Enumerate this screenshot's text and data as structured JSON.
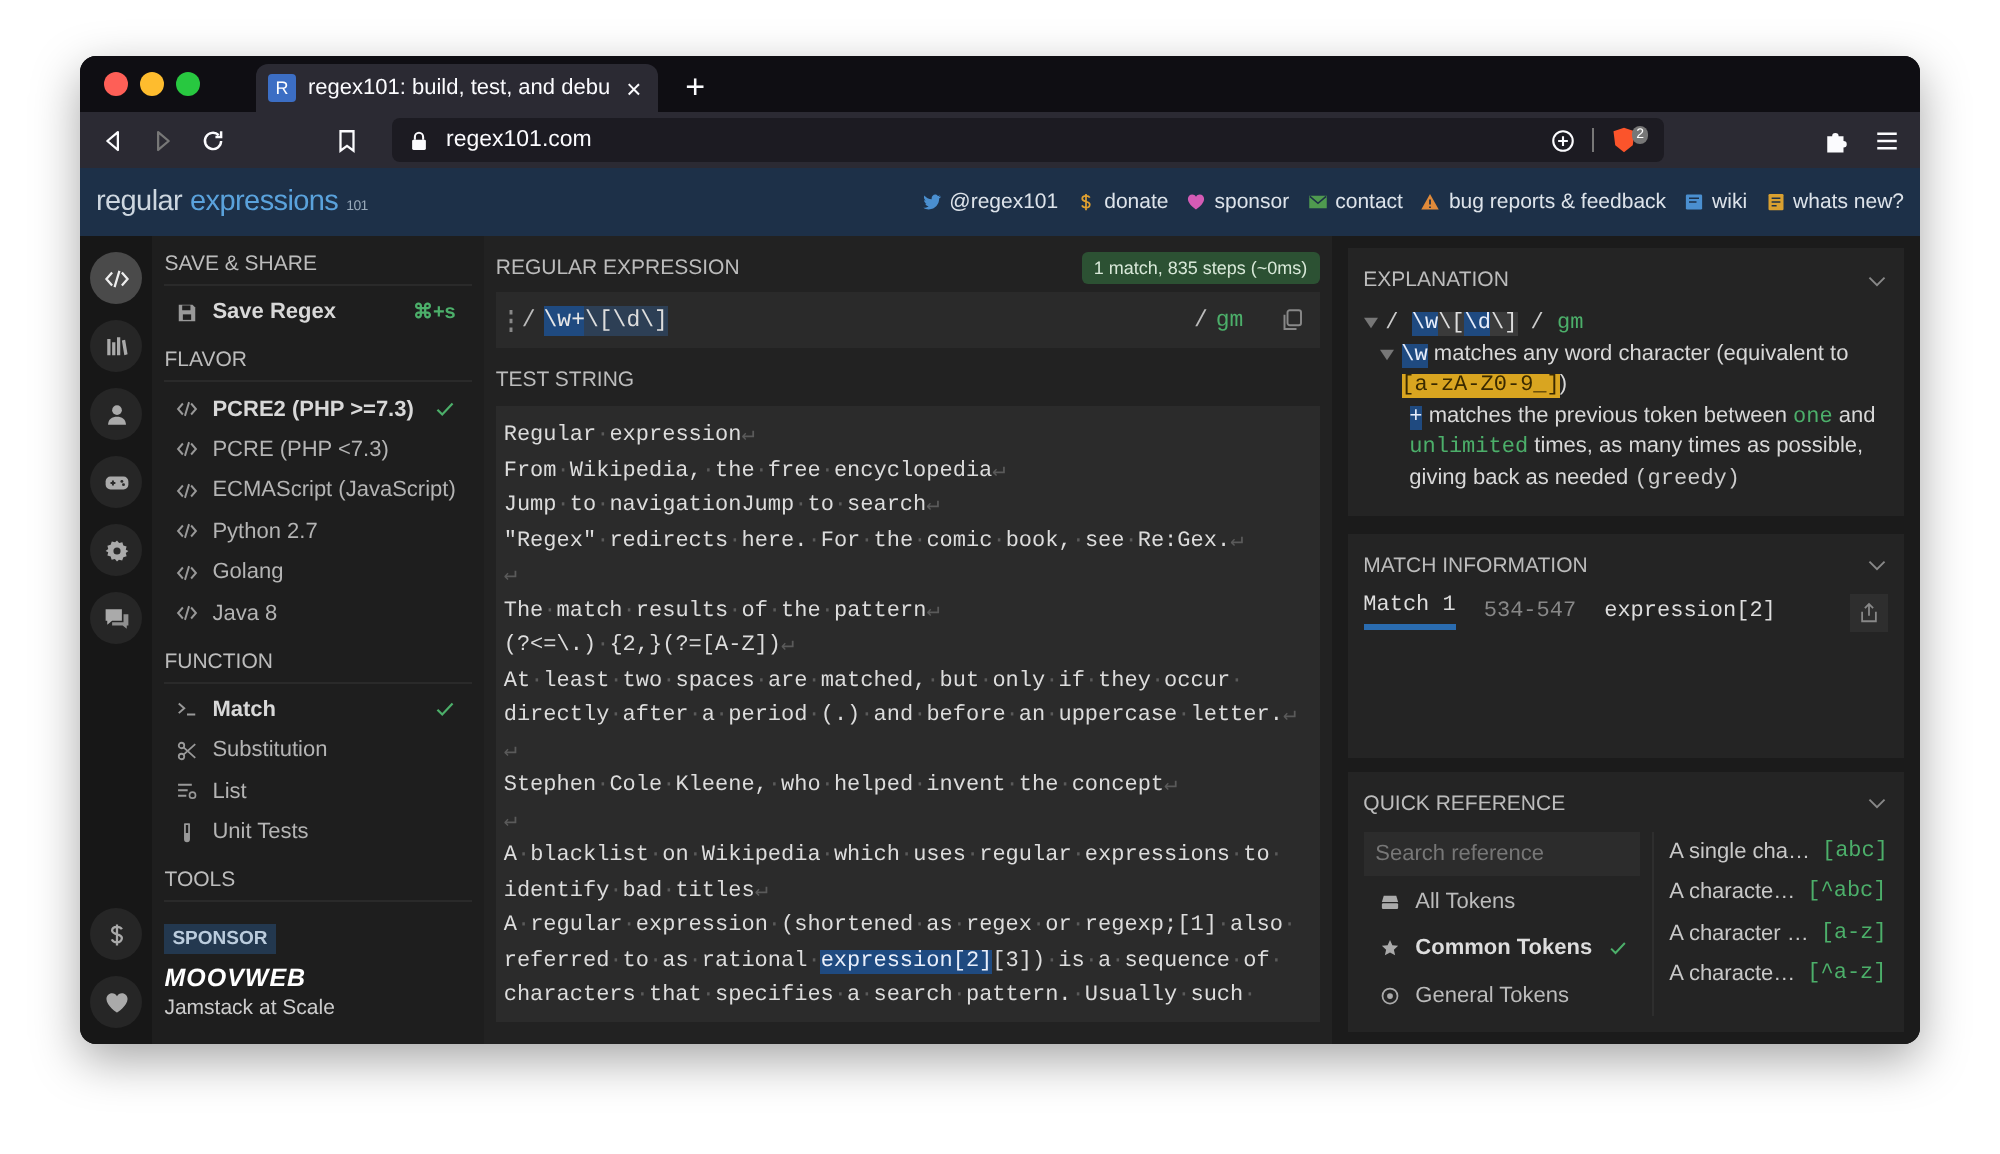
{
  "browser": {
    "favicon": "R",
    "tab_title": "regex101: build, test, and debu",
    "tab_close": "×",
    "new_tab": "+",
    "url": "regex101.com",
    "shield_count": "2"
  },
  "header": {
    "logo": {
      "word1": "regular",
      "word2": "expressions",
      "version": "101"
    },
    "links": [
      {
        "kind": "bird",
        "label": "@regex101",
        "color": "#4a8fd0"
      },
      {
        "kind": "dollar",
        "label": "donate",
        "color": "#e0a030"
      },
      {
        "kind": "heart",
        "label": "sponsor",
        "color": "#d45bb5"
      },
      {
        "kind": "mail",
        "label": "contact",
        "color": "#4f9a4f"
      },
      {
        "kind": "warning",
        "label": "bug reports & feedback",
        "color": "#e08a3a"
      },
      {
        "kind": "book",
        "label": "wiki",
        "color": "#4a8fd0"
      },
      {
        "kind": "note",
        "label": "whats new?",
        "color": "#d9a030"
      }
    ]
  },
  "rail": {
    "items": [
      {
        "kind": "code",
        "selected": true
      },
      {
        "kind": "library",
        "selected": false
      },
      {
        "kind": "user",
        "selected": false
      },
      {
        "kind": "gamepad",
        "selected": false
      },
      {
        "kind": "gear",
        "selected": false
      },
      {
        "kind": "chat",
        "selected": false
      }
    ],
    "bottom": [
      {
        "kind": "dollar"
      },
      {
        "kind": "heart"
      }
    ]
  },
  "sidebar": {
    "sections": [
      {
        "title": "SAVE & SHARE",
        "items": [
          {
            "kind": "save",
            "label": "Save Regex",
            "shortcut": "⌘+s"
          }
        ]
      },
      {
        "title": "FLAVOR",
        "items": [
          {
            "kind": "code",
            "label": "PCRE2 (PHP >=7.3)",
            "selected": true
          },
          {
            "kind": "code",
            "label": "PCRE (PHP <7.3)",
            "selected": false
          },
          {
            "kind": "code",
            "label": "ECMAScript (JavaScript)",
            "selected": false
          },
          {
            "kind": "code",
            "label": "Python 2.7",
            "selected": false
          },
          {
            "kind": "code",
            "label": "Golang",
            "selected": false
          },
          {
            "kind": "code",
            "label": "Java 8",
            "selected": false
          }
        ]
      },
      {
        "title": "FUNCTION",
        "items": [
          {
            "kind": "prompt",
            "label": "Match",
            "selected": true
          },
          {
            "kind": "scissors",
            "label": "Substitution",
            "selected": false
          },
          {
            "kind": "list",
            "label": "List",
            "selected": false
          },
          {
            "kind": "tube",
            "label": "Unit Tests",
            "selected": false
          }
        ]
      },
      {
        "title": "TOOLS"
      }
    ],
    "sponsor": {
      "badge": "SPONSOR",
      "brand": "MOOVWEB",
      "tagline": "Jamstack at Scale"
    }
  },
  "editor": {
    "regex_title": "REGULAR EXPRESSION",
    "status": "1 match, 835 steps (~0ms)",
    "delimiter": "/",
    "tokens": [
      {
        "text": "\\w+",
        "kind": "token"
      },
      {
        "text": "\\[\\d\\]",
        "kind": "literal"
      }
    ],
    "closing_delimiter": "/",
    "flags": "gm",
    "test_title": "TEST STRING",
    "lines": [
      {
        "text": "Regular·expression↵"
      },
      {
        "text": "From·Wikipedia,·the·free·encyclopedia↵"
      },
      {
        "text": "Jump·to·navigationJump·to·search↵"
      },
      {
        "text": "\"Regex\"·redirects·here.·For·the·comic·book,·see·Re:Gex.↵"
      },
      {
        "text": "↵"
      },
      {
        "text": "The·match·results·of·the·pattern↵"
      },
      {
        "text": "(?<=\\.)·{2,}(?=[A-Z])↵"
      },
      {
        "text": "At·least·two·spaces·are·matched,·but·only·if·they·occur·"
      },
      {
        "text": "directly·after·a·period·(.)·and·before·an·uppercase·letter.↵"
      },
      {
        "text": "↵"
      },
      {
        "text": "Stephen·Cole·Kleene,·who·helped·invent·the·concept↵"
      },
      {
        "text": "↵"
      },
      {
        "text": "A·blacklist·on·Wikipedia·which·uses·regular·expressions·to·"
      },
      {
        "text": "identify·bad·titles↵"
      },
      {
        "text": "A·regular·expression·(shortened·as·regex·or·regexp;[1]·also·"
      },
      {
        "parts": [
          {
            "text": "referred·to·as·rational·",
            "match": false
          },
          {
            "text": "expression[2]",
            "match": true
          },
          {
            "text": "[3])·is·a·sequence·of·",
            "match": false
          }
        ]
      },
      {
        "text": "characters·that·specifies·a·search·pattern.·Usually·such·"
      }
    ]
  },
  "explanation": {
    "title": "EXPLANATION",
    "tree": {
      "kind": "group",
      "expanded": true,
      "parts": [
        {
          "text": "/ ",
          "kind": "mono"
        },
        {
          "text": "\\w",
          "kind": "token"
        },
        {
          "text": "\\[",
          "kind": "literal"
        },
        {
          "text": "\\d",
          "kind": "token"
        },
        {
          "text": "\\]",
          "kind": "literal"
        },
        {
          "text": " / ",
          "kind": "mono"
        },
        {
          "text": "gm",
          "kind": "code"
        }
      ],
      "children": [
        {
          "kind": "group",
          "expanded": true,
          "parts": [
            {
              "text": "\\w",
              "kind": "token"
            },
            {
              "text": " matches any word character (equivalent to ",
              "kind": "plain"
            },
            {
              "text": "[a-zA-Z0-9_]",
              "kind": "class"
            },
            {
              "text": ")",
              "kind": "plain"
            }
          ],
          "children": [
            {
              "kind": "leaf",
              "parts": [
                {
                  "text": "+",
                  "kind": "token"
                },
                {
                  "text": " matches the previous token between ",
                  "kind": "plain"
                },
                {
                  "text": "one",
                  "kind": "code"
                },
                {
                  "text": " and ",
                  "kind": "plain"
                },
                {
                  "text": "unlimited",
                  "kind": "code"
                },
                {
                  "text": " times, as many times as possible, giving back as needed ",
                  "kind": "plain"
                },
                {
                  "text": "(greedy)",
                  "kind": "mono"
                }
              ]
            }
          ]
        }
      ]
    }
  },
  "match_info": {
    "title": "MATCH INFORMATION",
    "tabs": [
      {
        "label": "Match 1",
        "selected": true
      }
    ],
    "range": "534-547",
    "value": "expression[2]"
  },
  "quick_reference": {
    "title": "QUICK REFERENCE",
    "search_placeholder": "Search reference",
    "categories": [
      {
        "kind": "stack",
        "label": "All Tokens",
        "selected": false
      },
      {
        "kind": "star",
        "label": "Common Tokens",
        "selected": true
      },
      {
        "kind": "target",
        "label": "General Tokens",
        "selected": false
      }
    ],
    "tokens": [
      {
        "description": "A single cha…",
        "token": "[abc]"
      },
      {
        "description": "A characte…",
        "token": "[^abc]"
      },
      {
        "description": "A character …",
        "token": "[a-z]"
      },
      {
        "description": "A characte…",
        "token": "[^a-z]"
      }
    ]
  }
}
